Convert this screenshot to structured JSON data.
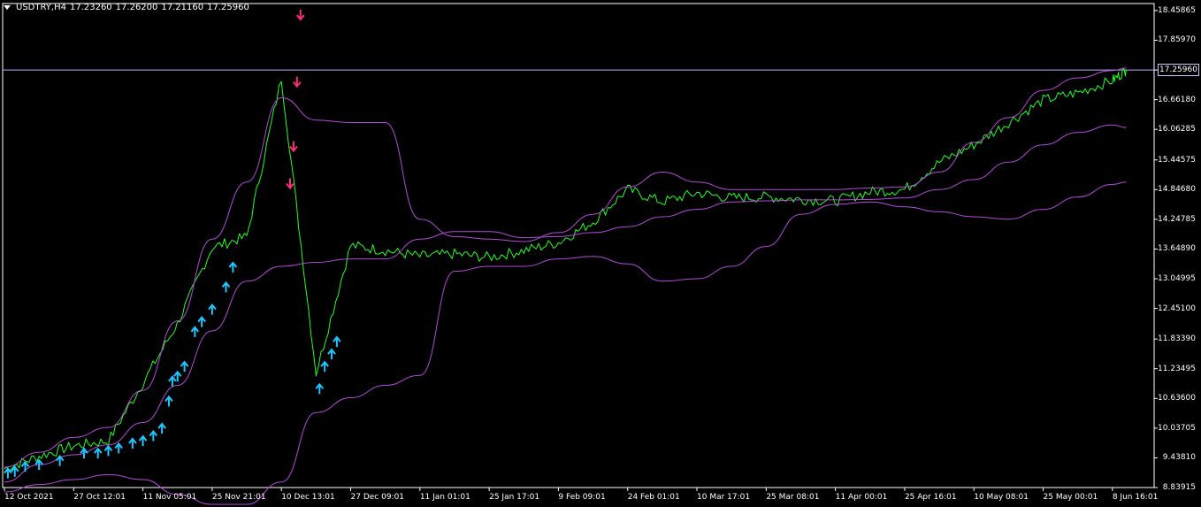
{
  "header": {
    "symbol": "USDTRY,H4",
    "open": "17.23260",
    "high": "17.26200",
    "low": "17.21160",
    "close": "17.25960"
  },
  "current_price_tag": "17.25960",
  "colors": {
    "background": "#000000",
    "price_line": "#22ff22",
    "bands": "#b44ad8",
    "sell_arrow": "#ff2a7a",
    "buy_arrow": "#1ec8ff",
    "current_price_line": "#b4b4ff",
    "axis": "#ffffff"
  },
  "chart_data": {
    "type": "line",
    "title": "",
    "xlabel": "",
    "ylabel": "",
    "ylim": [
      8.83915,
      18.6
    ],
    "y_ticks": [
      "18.45865",
      "17.85970",
      "17.25960",
      "16.66180",
      "16.06285",
      "15.44575",
      "14.84680",
      "14.24785",
      "13.64890",
      "13.04995",
      "12.45100",
      "11.83390",
      "11.23495",
      "10.63600",
      "10.03705",
      "9.43810",
      "8.83915"
    ],
    "x_ticks": [
      "12 Oct 2021",
      "27 Oct 12:01",
      "11 Nov 05:01",
      "25 Nov 21:01",
      "10 Dec 13:01",
      "27 Dec 09:01",
      "11 Jan 01:01",
      "25 Jan 17:01",
      "9 Feb 09:01",
      "24 Feb 01:01",
      "10 Mar 17:01",
      "25 Mar 08:01",
      "11 Apr 00:01",
      "25 Apr 16:01",
      "10 May 08:01",
      "25 May 00:01",
      "8 Jun 16:01"
    ],
    "x_tick_index": [
      0,
      2,
      4,
      6,
      8,
      10,
      12,
      14,
      16,
      18,
      20,
      22,
      24,
      26,
      28,
      30,
      32
    ],
    "x_index_max": 33,
    "series": [
      {
        "role": "price",
        "x": [
          0,
          1,
          2,
          3,
          4,
          5,
          6,
          7,
          8,
          9,
          10,
          11,
          12,
          13,
          14,
          15,
          16,
          17,
          18,
          19,
          20,
          21,
          22,
          23,
          24,
          25,
          26,
          27,
          28,
          29,
          30,
          31,
          32,
          32.4
        ],
        "values": [
          9.22,
          9.47,
          9.68,
          9.78,
          10.95,
          12.15,
          13.68,
          13.9,
          17.1,
          11.15,
          13.72,
          13.62,
          13.5,
          13.55,
          13.48,
          13.62,
          13.78,
          14.2,
          14.85,
          14.6,
          14.78,
          14.68,
          14.7,
          14.65,
          14.62,
          14.8,
          14.85,
          15.4,
          15.75,
          16.2,
          16.65,
          16.8,
          17.05,
          17.26
        ]
      },
      {
        "role": "upper band",
        "x": [
          0,
          1,
          2,
          3,
          4,
          5,
          6,
          7,
          8,
          9,
          10,
          11,
          12,
          13,
          14,
          15,
          16,
          17,
          18,
          19,
          20,
          21,
          22,
          23,
          24,
          25,
          26,
          27,
          28,
          29,
          30,
          31,
          32,
          32.4
        ],
        "values": [
          9.25,
          9.55,
          9.85,
          10.05,
          10.8,
          12.2,
          13.85,
          15.0,
          16.7,
          16.25,
          16.2,
          16.2,
          14.25,
          13.9,
          13.85,
          13.8,
          13.98,
          14.35,
          14.9,
          15.2,
          15.0,
          14.85,
          14.85,
          14.85,
          14.85,
          14.88,
          14.9,
          15.2,
          15.8,
          16.3,
          16.85,
          17.1,
          17.25,
          17.3
        ]
      },
      {
        "role": "middle band",
        "x": [
          0,
          1,
          2,
          3,
          4,
          5,
          6,
          7,
          8,
          9,
          10,
          11,
          12,
          13,
          14,
          15,
          16,
          17,
          18,
          19,
          20,
          21,
          22,
          23,
          24,
          25,
          26,
          27,
          28,
          29,
          30,
          31,
          32,
          32.4
        ],
        "values": [
          8.95,
          9.3,
          9.5,
          9.7,
          10.15,
          10.9,
          12.0,
          13.0,
          13.3,
          13.38,
          13.45,
          13.45,
          13.85,
          14.0,
          14.0,
          13.88,
          13.9,
          13.98,
          14.1,
          14.3,
          14.45,
          14.6,
          14.62,
          14.64,
          14.64,
          14.65,
          14.68,
          14.85,
          15.05,
          15.4,
          15.75,
          16.0,
          16.15,
          16.1
        ]
      },
      {
        "role": "lower band",
        "x": [
          0,
          1,
          2,
          3,
          4,
          5,
          6,
          7,
          8,
          9,
          10,
          11,
          12,
          13,
          14,
          15,
          16,
          17,
          18,
          19,
          20,
          21,
          22,
          23,
          24,
          25,
          26,
          27,
          28,
          29,
          30,
          31,
          32,
          32.4
        ],
        "values": [
          8.75,
          8.9,
          9.0,
          9.1,
          9.0,
          8.7,
          8.5,
          8.5,
          8.95,
          10.35,
          10.65,
          10.9,
          11.1,
          13.2,
          13.3,
          13.3,
          13.45,
          13.5,
          13.35,
          13.0,
          13.05,
          13.3,
          13.7,
          14.35,
          14.55,
          14.6,
          14.5,
          14.4,
          14.3,
          14.25,
          14.45,
          14.7,
          14.95,
          15.0
        ]
      }
    ],
    "sell_arrows": [
      {
        "x": 8.55,
        "y": 18.35
      },
      {
        "x": 8.45,
        "y": 17.0
      },
      {
        "x": 8.35,
        "y": 15.7
      },
      {
        "x": 8.25,
        "y": 14.95
      }
    ],
    "buy_arrows": [
      {
        "x": 0.1,
        "y": 9.15
      },
      {
        "x": 0.3,
        "y": 9.18
      },
      {
        "x": 0.6,
        "y": 9.28
      },
      {
        "x": 1.0,
        "y": 9.32
      },
      {
        "x": 1.6,
        "y": 9.4
      },
      {
        "x": 2.3,
        "y": 9.55
      },
      {
        "x": 2.7,
        "y": 9.55
      },
      {
        "x": 3.0,
        "y": 9.6
      },
      {
        "x": 3.3,
        "y": 9.65
      },
      {
        "x": 3.7,
        "y": 9.75
      },
      {
        "x": 4.0,
        "y": 9.8
      },
      {
        "x": 4.3,
        "y": 9.9
      },
      {
        "x": 4.55,
        "y": 10.05
      },
      {
        "x": 4.75,
        "y": 10.6
      },
      {
        "x": 4.85,
        "y": 11.0
      },
      {
        "x": 5.0,
        "y": 11.1
      },
      {
        "x": 5.2,
        "y": 11.3
      },
      {
        "x": 5.5,
        "y": 12.0
      },
      {
        "x": 5.7,
        "y": 12.2
      },
      {
        "x": 6.0,
        "y": 12.45
      },
      {
        "x": 6.4,
        "y": 12.9
      },
      {
        "x": 6.6,
        "y": 13.3
      },
      {
        "x": 9.1,
        "y": 10.85
      },
      {
        "x": 9.25,
        "y": 11.3
      },
      {
        "x": 9.45,
        "y": 11.55
      },
      {
        "x": 9.6,
        "y": 11.8
      }
    ],
    "current_price": 17.2596,
    "grid": false,
    "legend": "none"
  }
}
